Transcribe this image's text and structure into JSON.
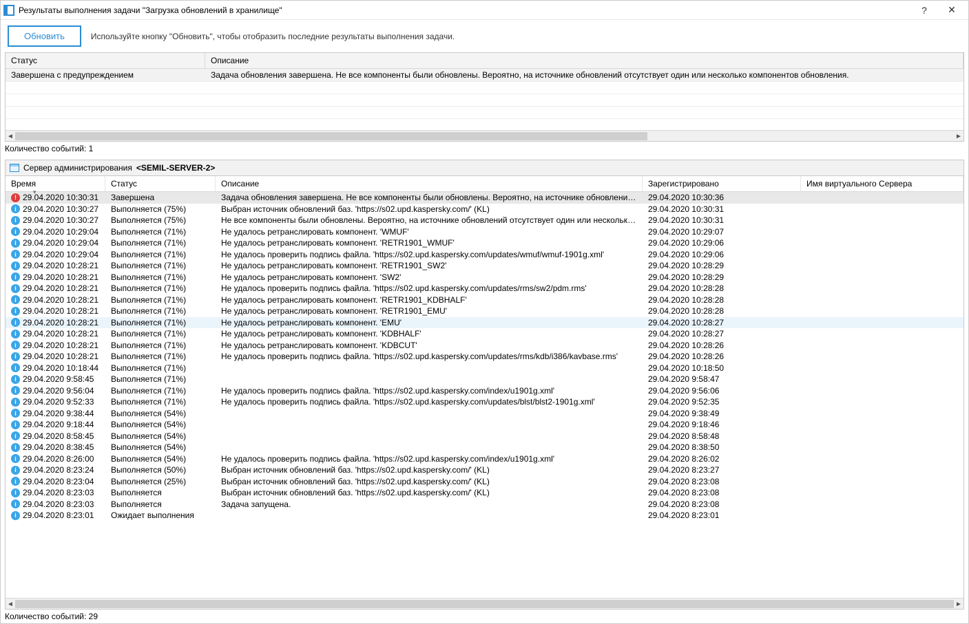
{
  "window": {
    "title": "Результаты выполнения задачи \"Загрузка обновлений в хранилище\"",
    "help": "?",
    "close": "✕"
  },
  "toolbar": {
    "refresh_label": "Обновить",
    "hint": "Используйте кнопку \"Обновить\", чтобы отобразить последние результаты выполнения задачи."
  },
  "top_grid": {
    "headers": {
      "status": "Статус",
      "desc": "Описание"
    },
    "row": {
      "status": "Завершена с предупреждением",
      "desc": "Задача обновления завершена. Не все компоненты были обновлены. Вероятно, на источнике обновлений отсутствует один или несколько компонентов обновления."
    },
    "count_label": "Количество событий: 1"
  },
  "server_header": {
    "prefix": "Сервер администрирования",
    "name": "<SEMIL-SERVER-2>"
  },
  "events": {
    "headers": {
      "time": "Время",
      "status": "Статус",
      "desc": "Описание",
      "registered": "Зарегистрировано",
      "vserver": "Имя виртуального Сервера"
    },
    "rows": [
      {
        "icon": "error",
        "time": "29.04.2020 10:30:31",
        "status": "Завершена",
        "desc": "Задача обновления завершена. Не все компоненты были обновлены. Вероятно, на источнике обновлений отсутствует...",
        "reg": "29.04.2020 10:30:36",
        "sel": "dark"
      },
      {
        "icon": "info",
        "time": "29.04.2020 10:30:27",
        "status": "Выполняется (75%)",
        "desc": "Выбран источник обновлений баз. 'https://s02.upd.kaspersky.com/' (KL)",
        "reg": "29.04.2020 10:30:31"
      },
      {
        "icon": "info",
        "time": "29.04.2020 10:30:27",
        "status": "Выполняется (75%)",
        "desc": "Не все компоненты были обновлены. Вероятно, на источнике обновлений отсутствует один или несколько компонент...",
        "reg": "29.04.2020 10:30:31"
      },
      {
        "icon": "info",
        "time": "29.04.2020 10:29:04",
        "status": "Выполняется (71%)",
        "desc": "Не удалось ретранслировать компонент. 'WMUF'",
        "reg": "29.04.2020 10:29:07"
      },
      {
        "icon": "info",
        "time": "29.04.2020 10:29:04",
        "status": "Выполняется (71%)",
        "desc": "Не удалось ретранслировать компонент. 'RETR1901_WMUF'",
        "reg": "29.04.2020 10:29:06"
      },
      {
        "icon": "info",
        "time": "29.04.2020 10:29:04",
        "status": "Выполняется (71%)",
        "desc": "Не удалось проверить подпись файла. 'https://s02.upd.kaspersky.com/updates/wmuf/wmuf-1901g.xml'",
        "reg": "29.04.2020 10:29:06"
      },
      {
        "icon": "info",
        "time": "29.04.2020 10:28:21",
        "status": "Выполняется (71%)",
        "desc": "Не удалось ретранслировать компонент. 'RETR1901_SW2'",
        "reg": "29.04.2020 10:28:29"
      },
      {
        "icon": "info",
        "time": "29.04.2020 10:28:21",
        "status": "Выполняется (71%)",
        "desc": "Не удалось ретранслировать компонент. 'SW2'",
        "reg": "29.04.2020 10:28:29"
      },
      {
        "icon": "info",
        "time": "29.04.2020 10:28:21",
        "status": "Выполняется (71%)",
        "desc": "Не удалось проверить подпись файла. 'https://s02.upd.kaspersky.com/updates/rms/sw2/pdm.rms'",
        "reg": "29.04.2020 10:28:28"
      },
      {
        "icon": "info",
        "time": "29.04.2020 10:28:21",
        "status": "Выполняется (71%)",
        "desc": "Не удалось ретранслировать компонент. 'RETR1901_KDBHALF'",
        "reg": "29.04.2020 10:28:28"
      },
      {
        "icon": "info",
        "time": "29.04.2020 10:28:21",
        "status": "Выполняется (71%)",
        "desc": "Не удалось ретранслировать компонент. 'RETR1901_EMU'",
        "reg": "29.04.2020 10:28:28"
      },
      {
        "icon": "info",
        "time": "29.04.2020 10:28:21",
        "status": "Выполняется (71%)",
        "desc": "Не удалось ретранслировать компонент. 'EMU'",
        "reg": "29.04.2020 10:28:27",
        "sel": "light"
      },
      {
        "icon": "info",
        "time": "29.04.2020 10:28:21",
        "status": "Выполняется (71%)",
        "desc": "Не удалось ретранслировать компонент. 'KDBHALF'",
        "reg": "29.04.2020 10:28:27"
      },
      {
        "icon": "info",
        "time": "29.04.2020 10:28:21",
        "status": "Выполняется (71%)",
        "desc": "Не удалось ретранслировать компонент. 'KDBCUT'",
        "reg": "29.04.2020 10:28:26"
      },
      {
        "icon": "info",
        "time": "29.04.2020 10:28:21",
        "status": "Выполняется (71%)",
        "desc": "Не удалось проверить подпись файла. 'https://s02.upd.kaspersky.com/updates/rms/kdb/i386/kavbase.rms'",
        "reg": "29.04.2020 10:28:26"
      },
      {
        "icon": "info",
        "time": "29.04.2020 10:18:44",
        "status": "Выполняется (71%)",
        "desc": "",
        "reg": "29.04.2020 10:18:50"
      },
      {
        "icon": "info",
        "time": "29.04.2020 9:58:45",
        "status": "Выполняется (71%)",
        "desc": "",
        "reg": "29.04.2020 9:58:47"
      },
      {
        "icon": "info",
        "time": "29.04.2020 9:56:04",
        "status": "Выполняется (71%)",
        "desc": "Не удалось проверить подпись файла. 'https://s02.upd.kaspersky.com/index/u1901g.xml'",
        "reg": "29.04.2020 9:56:06"
      },
      {
        "icon": "info",
        "time": "29.04.2020 9:52:33",
        "status": "Выполняется (71%)",
        "desc": "Не удалось проверить подпись файла. 'https://s02.upd.kaspersky.com/updates/blst/blst2-1901g.xml'",
        "reg": "29.04.2020 9:52:35"
      },
      {
        "icon": "info",
        "time": "29.04.2020 9:38:44",
        "status": "Выполняется (54%)",
        "desc": "",
        "reg": "29.04.2020 9:38:49"
      },
      {
        "icon": "info",
        "time": "29.04.2020 9:18:44",
        "status": "Выполняется (54%)",
        "desc": "",
        "reg": "29.04.2020 9:18:46"
      },
      {
        "icon": "info",
        "time": "29.04.2020 8:58:45",
        "status": "Выполняется (54%)",
        "desc": "",
        "reg": "29.04.2020 8:58:48"
      },
      {
        "icon": "info",
        "time": "29.04.2020 8:38:45",
        "status": "Выполняется (54%)",
        "desc": "",
        "reg": "29.04.2020 8:38:50"
      },
      {
        "icon": "info",
        "time": "29.04.2020 8:26:00",
        "status": "Выполняется (54%)",
        "desc": "Не удалось проверить подпись файла. 'https://s02.upd.kaspersky.com/index/u1901g.xml'",
        "reg": "29.04.2020 8:26:02"
      },
      {
        "icon": "info",
        "time": "29.04.2020 8:23:24",
        "status": "Выполняется (50%)",
        "desc": "Выбран источник обновлений баз. 'https://s02.upd.kaspersky.com/' (KL)",
        "reg": "29.04.2020 8:23:27"
      },
      {
        "icon": "info",
        "time": "29.04.2020 8:23:04",
        "status": "Выполняется (25%)",
        "desc": "Выбран источник обновлений баз. 'https://s02.upd.kaspersky.com/' (KL)",
        "reg": "29.04.2020 8:23:08"
      },
      {
        "icon": "info",
        "time": "29.04.2020 8:23:03",
        "status": "Выполняется",
        "desc": "Выбран источник обновлений баз. 'https://s02.upd.kaspersky.com/' (KL)",
        "reg": "29.04.2020 8:23:08"
      },
      {
        "icon": "info",
        "time": "29.04.2020 8:23:03",
        "status": "Выполняется",
        "desc": "Задача запущена.",
        "reg": "29.04.2020 8:23:08"
      },
      {
        "icon": "info",
        "time": "29.04.2020 8:23:01",
        "status": "Ожидает выполнения",
        "desc": "",
        "reg": "29.04.2020 8:23:01"
      }
    ],
    "count_label": "Количество событий: 29"
  }
}
